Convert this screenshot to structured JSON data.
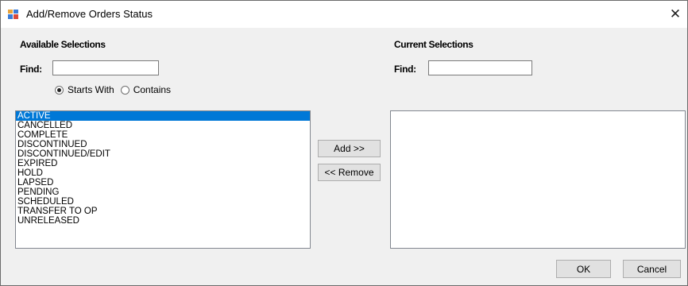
{
  "window": {
    "title": "Add/Remove Orders Status",
    "close_glyph": "✕"
  },
  "available": {
    "heading": "Available Selections",
    "find_label": "Find:",
    "find_value": "",
    "search_modes": [
      {
        "label": "Starts With",
        "checked": true
      },
      {
        "label": "Contains",
        "checked": false
      }
    ],
    "items": [
      "ACTIVE",
      "CANCELLED",
      "COMPLETE",
      "DISCONTINUED",
      "DISCONTINUED/EDIT",
      "EXPIRED",
      "HOLD",
      "LAPSED",
      "PENDING",
      "SCHEDULED",
      "TRANSFER TO OP",
      "UNRELEASED"
    ],
    "selected_index": 0
  },
  "current": {
    "heading": "Current Selections",
    "find_label": "Find:",
    "find_value": "",
    "items": []
  },
  "actions": {
    "add_label": "Add >>",
    "remove_label": "<< Remove"
  },
  "footer": {
    "ok_label": "OK",
    "cancel_label": "Cancel"
  },
  "colors": {
    "selection": "#0078d7",
    "window_bg": "#f0f0f0"
  }
}
